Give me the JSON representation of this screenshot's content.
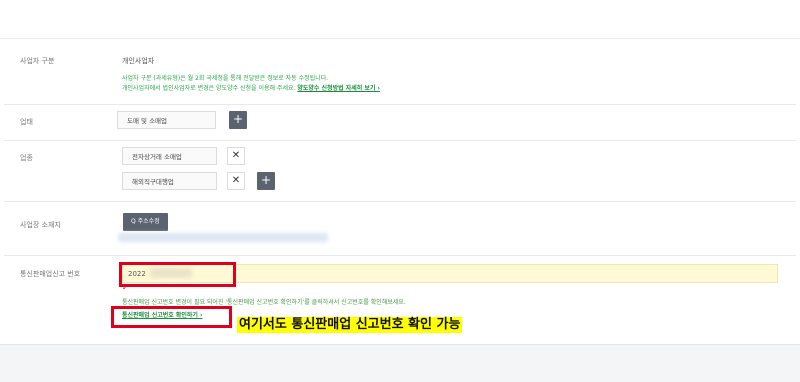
{
  "business_type": {
    "label": "사업자 구분",
    "value": "개인사업자",
    "note_line1": "사업자 구분 (과세유형)은 월 2회 국세청을 통해 전달받은 정보로 자동 수정됩니다.",
    "note_line2": "개인사업자에서 법인사업자로 변경은 양도양수 신청을 이용해 주세요.",
    "note_link": "양도양수 신청방법 자세히 보기 ›"
  },
  "business_category": {
    "label": "업태",
    "value": "도매 및 소매업",
    "add_icon": "plus-icon",
    "add_label": "+"
  },
  "business_item": {
    "label": "업종",
    "items": [
      "전자상거래 소매업",
      "해외직구대행업"
    ],
    "remove_label": "✕",
    "add_label": "+"
  },
  "business_address": {
    "label": "사업장 소재지",
    "search_button": "Q 주소수정"
  },
  "mail_order": {
    "label": "통신판매업신고 번호",
    "value": "2022",
    "check_mark": "✓",
    "note": "통신판매업 신고번호 변경이 필요 되어진 '통신판매업 신고번호 확인하기'를 클릭하셔서 신고번호를 확인해보세요.",
    "link": "통신판매업 신고번호 확인하기 ›"
  },
  "annotation": {
    "caption": "여기서도 통신판매업 신고번호 확인 가능",
    "highlight_color": "#ffff00",
    "box_color": "#e0001b"
  }
}
